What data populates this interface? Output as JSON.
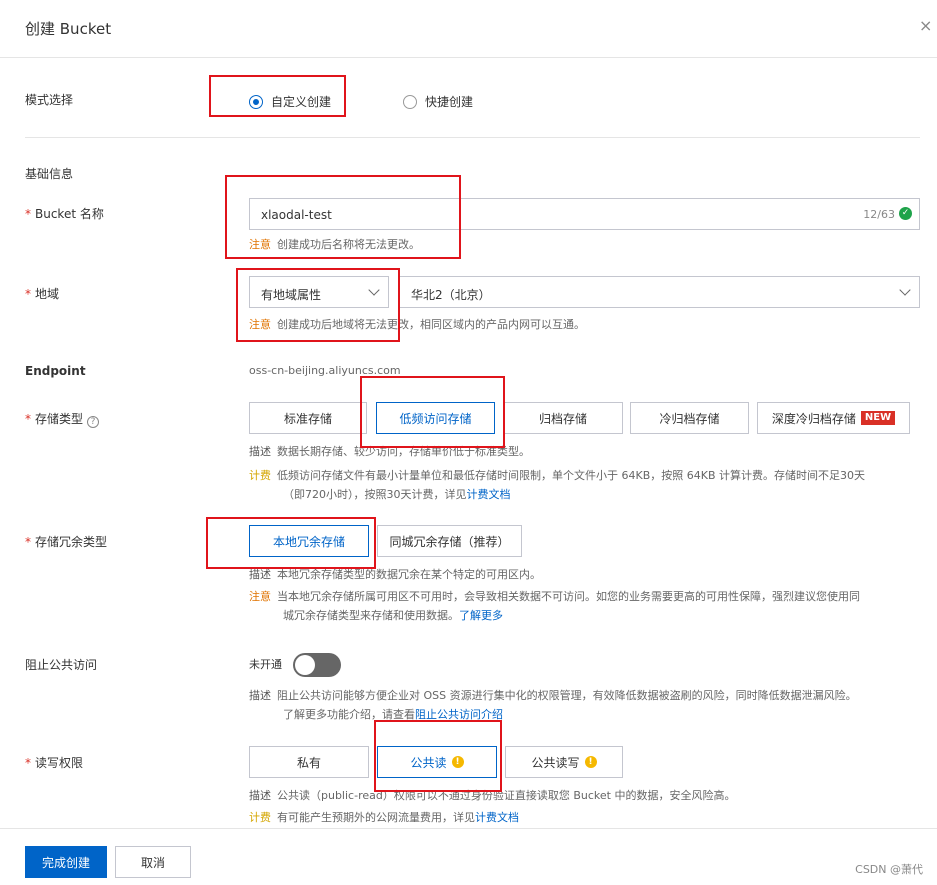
{
  "dialog": {
    "title": "创建 Bucket",
    "close_glyph": "×"
  },
  "mode": {
    "label": "模式选择",
    "options": [
      {
        "label": "自定义创建",
        "selected": true
      },
      {
        "label": "快捷创建",
        "selected": false
      }
    ]
  },
  "basic_info": {
    "heading": "基础信息"
  },
  "bucket_name": {
    "label": "Bucket 名称",
    "required_mark": "*",
    "value": "xlaodal-test",
    "count": "12/63",
    "note_tag": "注意",
    "note": "创建成功后名称将无法更改。"
  },
  "region": {
    "label": "地域",
    "required_mark": "*",
    "attr_select": "有地域属性",
    "region_select": "华北2（北京）",
    "note_tag": "注意",
    "note": "创建成功后地域将无法更改，相同区域内的产品内网可以互通。"
  },
  "endpoint": {
    "label": "Endpoint",
    "value": "oss-cn-beijing.aliyuncs.com"
  },
  "storage_class": {
    "label": "存储类型",
    "required_mark": "*",
    "help_glyph": "?",
    "options": [
      {
        "label": "标准存储",
        "active": false
      },
      {
        "label": "低频访问存储",
        "active": true
      },
      {
        "label": "归档存储",
        "active": false
      },
      {
        "label": "冷归档存储",
        "active": false
      },
      {
        "label": "深度冷归档存储",
        "active": false,
        "badge": "NEW"
      }
    ],
    "desc_tag": "描述",
    "desc": "数据长期存储、较少访问，存储单价低于标准类型。",
    "fee_tag": "计费",
    "fee_line1": "低频访问存储文件有最小计量单位和最低存储时间限制，单个文件小于 64KB，按照 64KB 计算计费。存储时间不足30天",
    "fee_line2": "（即720小时），按照30天计费，详见",
    "fee_link": "计费文档"
  },
  "redundancy": {
    "label": "存储冗余类型",
    "required_mark": "*",
    "options": [
      {
        "label": "本地冗余存储",
        "active": true
      },
      {
        "label": "同城冗余存储（推荐）",
        "active": false
      }
    ],
    "desc_tag": "描述",
    "desc": "本地冗余存储类型的数据冗余在某个特定的可用区内。",
    "warn_tag": "注意",
    "warn_line1": "当本地冗余存储所属可用区不可用时，会导致相关数据不可访问。如您的业务需要更高的可用性保障，强烈建议您使用同",
    "warn_line2": "城冗余存储类型来存储和使用数据。",
    "warn_link": "了解更多"
  },
  "block_public": {
    "label": "阻止公共访问",
    "state": "未开通",
    "enabled": false,
    "desc_tag": "描述",
    "desc_line1": "阻止公共访问能够方便企业对 OSS 资源进行集中化的权限管理，有效降低数据被盗刷的风险，同时降低数据泄漏风险。",
    "desc_line2": "了解更多功能介绍，请查看",
    "desc_link": "阻止公共访问介绍"
  },
  "acl": {
    "label": "读写权限",
    "required_mark": "*",
    "warn_glyph": "!",
    "options": [
      {
        "label": "私有",
        "active": false
      },
      {
        "label": "公共读",
        "active": true
      },
      {
        "label": "公共读写",
        "active": false
      }
    ],
    "desc_tag": "描述",
    "desc": "公共读（public-read）权限可以不通过身份验证直接读取您 Bucket 中的数据，安全风险高。",
    "fee_tag": "计费",
    "fee": "有可能产生预期外的公网流量费用，详见",
    "fee_link": "计费文档"
  },
  "footer": {
    "submit": "完成创建",
    "cancel": "取消",
    "watermark": "CSDN @萧代"
  },
  "colors": {
    "primary": "#0064c8",
    "annotation_red": "#e0141b",
    "warn": "#e07300",
    "required": "#d93026"
  }
}
